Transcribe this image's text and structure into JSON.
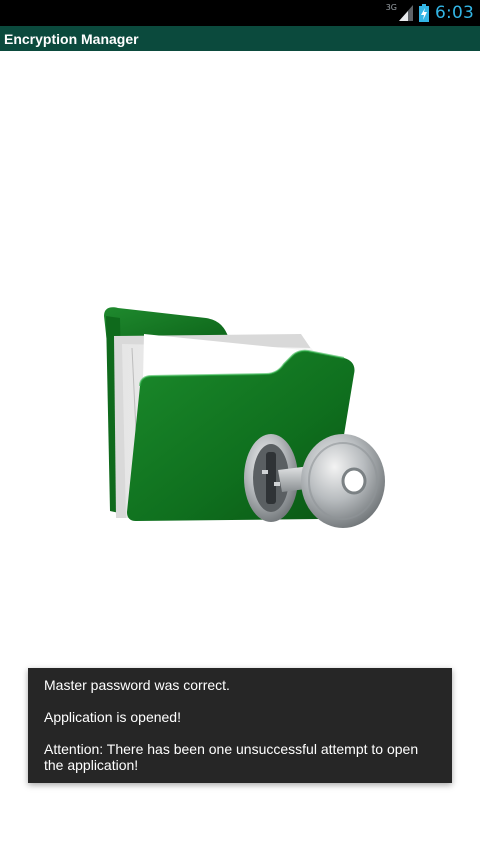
{
  "status_bar": {
    "network_type": "3G",
    "time": "6:03",
    "icons": [
      "signal-icon",
      "battery-charging-icon"
    ],
    "accent_color": "#33b5e5"
  },
  "action_bar": {
    "title": "Encryption Manager",
    "background_color": "#0b4a3d"
  },
  "main": {
    "image": "locked-folder-with-key-icon"
  },
  "toast": {
    "line1": "Master password was correct.",
    "line2": "Application is opened!",
    "line3": "Attention: There has been one unsuccessful attempt to open the application!"
  }
}
